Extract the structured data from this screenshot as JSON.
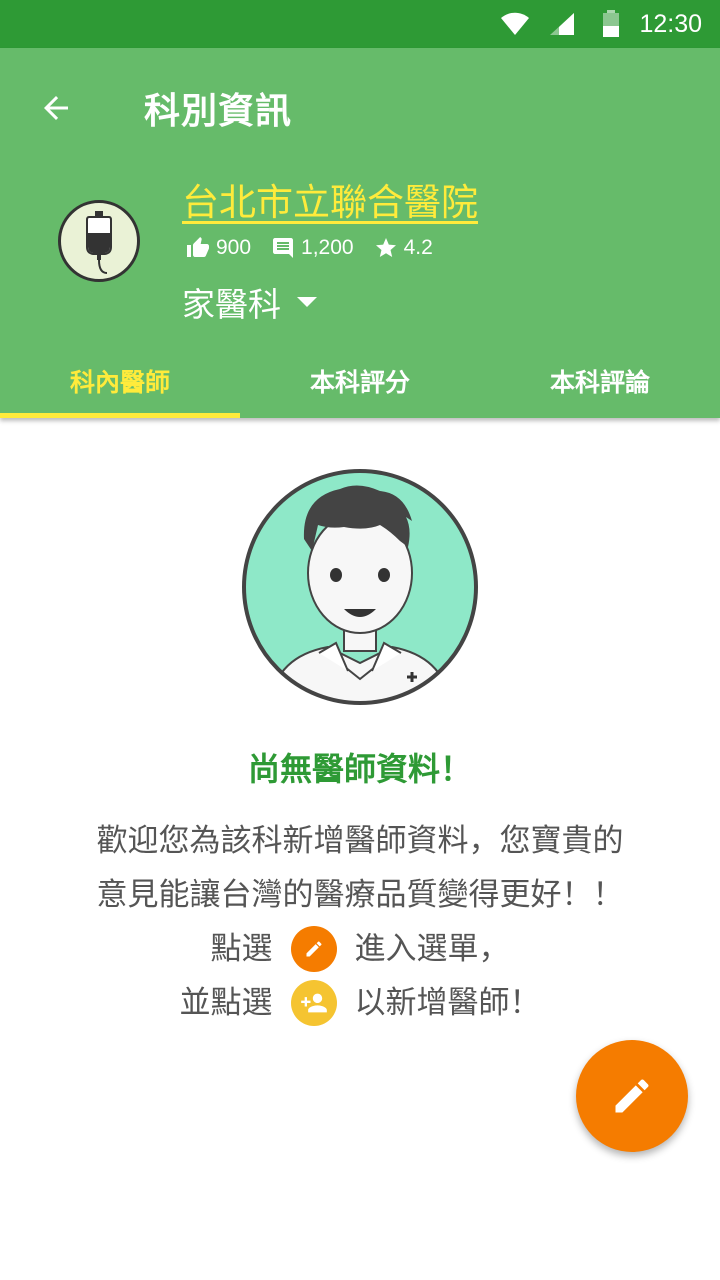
{
  "status_bar": {
    "time": "12:30"
  },
  "header": {
    "title": "科別資訊"
  },
  "hospital": {
    "name": "台北市立聯合醫院",
    "likes": "900",
    "comments": "1,200",
    "rating": "4.2",
    "department": "家醫科"
  },
  "tabs": [
    {
      "label": "科內醫師"
    },
    {
      "label": "本科評分"
    },
    {
      "label": "本科評論"
    }
  ],
  "empty_state": {
    "title": "尚無醫師資料！",
    "line1": "歡迎您為該科新增醫師資料，您寶貴的",
    "line2": "意見能讓台灣的醫療品質變得更好！！",
    "line3_pre": "點選",
    "line3_post": "進入選單，",
    "line4_pre": "並點選",
    "line4_post": "以新增醫師！"
  },
  "colors": {
    "status_bar": "#2e9a35",
    "app_bar": "#66bb6a",
    "accent_yellow": "#ffeb3b",
    "fab_orange": "#f57c00",
    "badge_yellow": "#f5c431",
    "title_green": "#2e9a35"
  },
  "icons": {
    "back": "arrow-left-icon",
    "like": "thumb-up-icon",
    "comment": "comment-icon",
    "rating": "star-icon",
    "edit": "pencil-icon",
    "add_person": "person-add-icon"
  }
}
